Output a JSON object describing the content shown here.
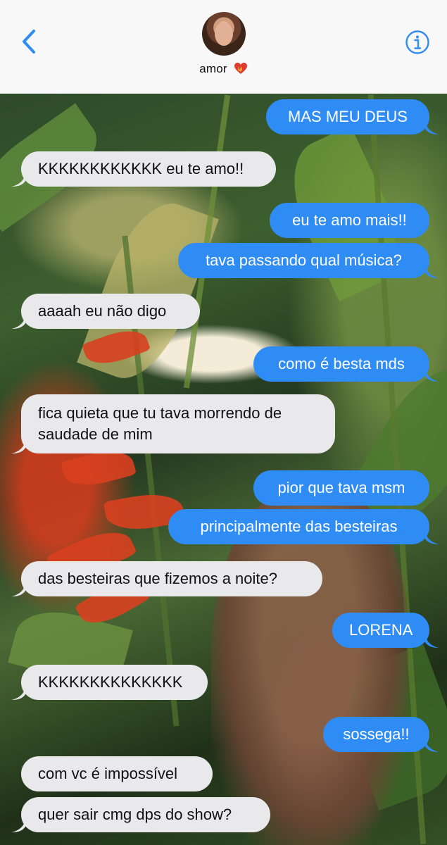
{
  "header": {
    "contact_name": "amor",
    "back_icon": "chevron-left-icon",
    "info_icon": "info-circle-icon",
    "name_emoji_icon": "heart-on-fire-icon",
    "accent_color": "#2f8cf5"
  },
  "messages": [
    {
      "from": "me",
      "text": "MAS MEU DEUS"
    },
    {
      "from": "them",
      "text": "KKKKKKKKKKKK eu te amo!!"
    },
    {
      "from": "me",
      "text": "eu te amo mais!!"
    },
    {
      "from": "me",
      "text": "tava passando qual música?"
    },
    {
      "from": "them",
      "text": "aaaah eu não digo"
    },
    {
      "from": "me",
      "text": "como é besta mds"
    },
    {
      "from": "them",
      "line1": "fica quieta que tu tava morrendo de",
      "line2": "saudade de mim"
    },
    {
      "from": "me",
      "text": "pior que tava msm"
    },
    {
      "from": "me",
      "text": "principalmente das besteiras"
    },
    {
      "from": "them",
      "text": "das besteiras que fizemos a noite?"
    },
    {
      "from": "me",
      "text": "LORENA"
    },
    {
      "from": "them",
      "text": "KKKKKKKKKKKKKK"
    },
    {
      "from": "me",
      "text": "sossega!!"
    },
    {
      "from": "them",
      "text": "com vc é impossível"
    },
    {
      "from": "them",
      "text": "quer sair cmg dps do show?"
    }
  ],
  "colors": {
    "sent_bubble": "#2f8cf5",
    "received_bubble": "#e9e9eb"
  }
}
